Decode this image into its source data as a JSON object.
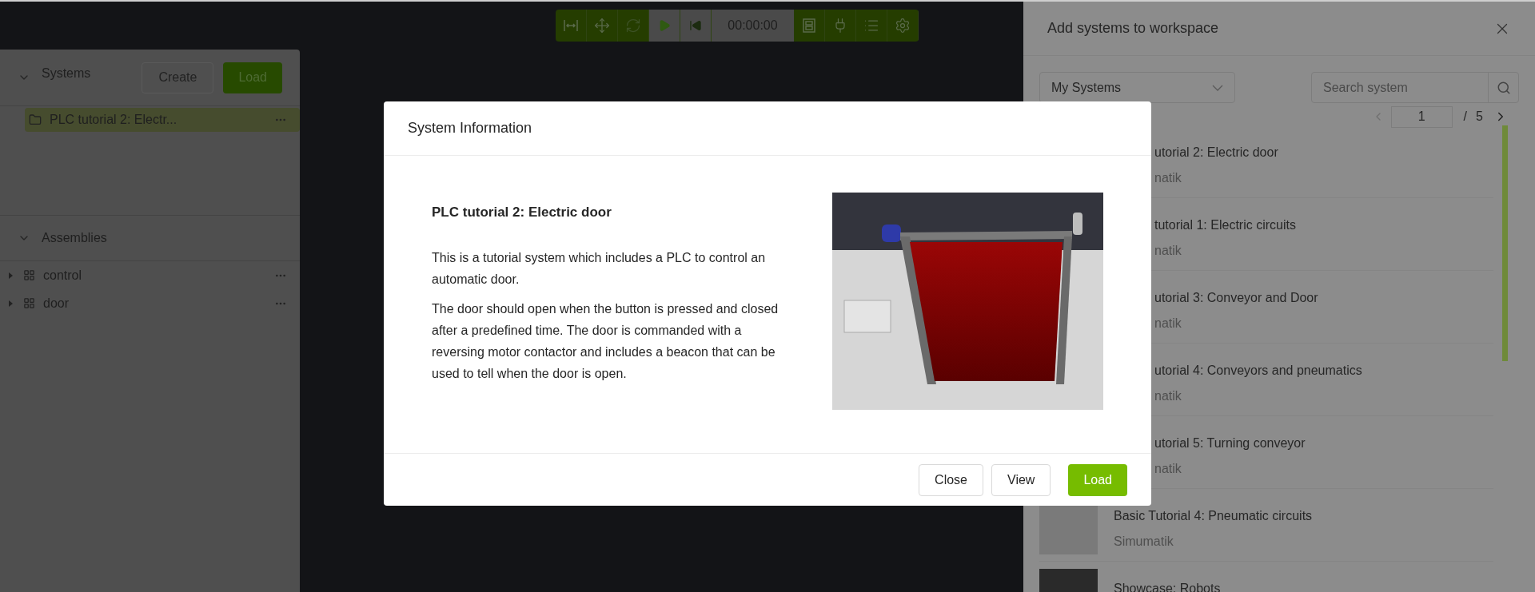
{
  "toolbar": {
    "time": "00:00:00"
  },
  "systems_panel": {
    "title": "Systems",
    "expanded": true,
    "create_button": "Create",
    "load_button": "Load",
    "items": [
      {
        "label": "PLC tutorial 2: Electr...",
        "selected": true
      }
    ]
  },
  "assemblies_panel": {
    "title": "Assemblies",
    "expanded": true,
    "items": [
      {
        "label": "control",
        "expanded": false
      },
      {
        "label": "door",
        "expanded": false
      }
    ]
  },
  "drawer": {
    "title": "Add systems to workspace",
    "filter": "My Systems",
    "search": {
      "placeholder": "Search system"
    },
    "pagination": {
      "page": "1",
      "total": "/ 5"
    },
    "items": [
      {
        "kind": "covered",
        "title": "utorial 2: Electric door",
        "publisher": "natik"
      },
      {
        "kind": "covered",
        "title": "tutorial 1: Electric circuits",
        "publisher": "natik"
      },
      {
        "kind": "covered",
        "title": "utorial 3: Conveyor and Door",
        "publisher": "natik"
      },
      {
        "kind": "covered",
        "title": "utorial 4: Conveyors and pneumatics",
        "publisher": "natik"
      },
      {
        "kind": "covered",
        "title": "utorial 5: Turning conveyor",
        "publisher": "natik"
      },
      {
        "kind": "full",
        "title": "Basic Tutorial 4: Pneumatic circuits",
        "publisher": "Simumatik"
      },
      {
        "kind": "full",
        "title": "Showcase: Robots"
      }
    ]
  },
  "modal": {
    "title": "System Information",
    "system_name": "PLC tutorial 2: Electric door",
    "description": [
      "This is a tutorial system which includes a PLC to control an automatic door.",
      "The door should open when the button is pressed and closed after a predefined time. The door is commanded with a reversing motor contactor and includes a beacon that can be used to tell when the door is open."
    ],
    "buttons": [
      {
        "label": "Close",
        "kind": "default"
      },
      {
        "label": "View",
        "kind": "default"
      },
      {
        "label": "Load",
        "kind": "primary"
      }
    ]
  }
}
